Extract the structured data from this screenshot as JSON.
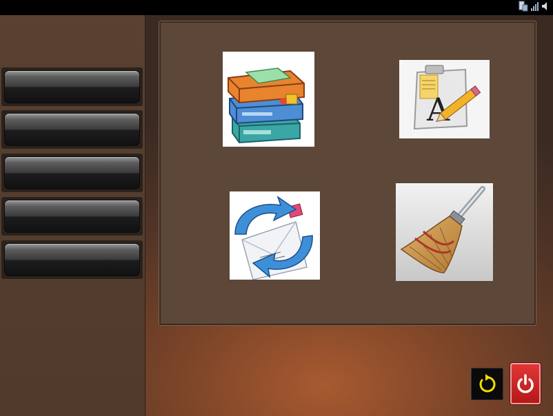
{
  "sidebar": {
    "buttons": [
      {
        "label": ""
      },
      {
        "label": ""
      },
      {
        "label": ""
      },
      {
        "label": ""
      },
      {
        "label": ""
      }
    ]
  },
  "main": {
    "tiles": [
      {
        "icon": "books-icon"
      },
      {
        "icon": "font-edit-icon"
      },
      {
        "icon": "mail-sync-icon"
      },
      {
        "icon": "broom-icon"
      }
    ]
  },
  "controls": {
    "refresh_icon": "refresh-icon",
    "power_icon": "power-icon"
  },
  "colors": {
    "background": "#4e3326",
    "panel": "#5c4738",
    "power": "#d02020",
    "refresh_arrow": "#f2e000"
  }
}
